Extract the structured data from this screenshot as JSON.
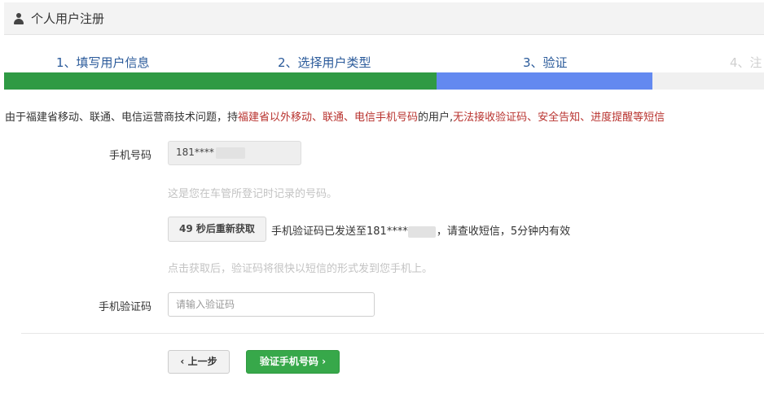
{
  "header": {
    "title": "个人用户注册",
    "icon": "user-icon"
  },
  "steps": [
    {
      "label": "1、填写用户信息"
    },
    {
      "label": "2、选择用户类型"
    },
    {
      "label": "3、验证"
    },
    {
      "label": "4、注"
    }
  ],
  "colors": {
    "step_done": "#2f9a44",
    "step_current": "#6389f0",
    "step_todo": "#f0f0f0",
    "warning_red": "#b8322e",
    "primary_green": "#37a84a"
  },
  "notice": {
    "part1": "由于福建省移动、联通、电信运营商技术问题，持",
    "part2": "福建省以外移动、联通、电信手机号码",
    "part3": "的用户,",
    "part4": "无法接收验证码、安全告知、进度提醒等短信"
  },
  "form": {
    "phone_label": "手机号码",
    "phone_value": "181****",
    "phone_hint": "这是您在车管所登记时记录的号码。",
    "resend_button": "49 秒后重新获取",
    "sent_message_prefix": "手机验证码已发送至181****",
    "sent_message_suffix": "，请查收短信，5分钟内有效",
    "resend_hint": "点击获取后，验证码将很快以短信的形式发到您手机上。",
    "code_label": "手机验证码",
    "code_placeholder": "请输入验证码",
    "code_value": ""
  },
  "buttons": {
    "prev": "上一步",
    "prev_icon": "chevron-left-icon",
    "verify": "验证手机号码",
    "verify_icon": "chevron-right-icon"
  }
}
